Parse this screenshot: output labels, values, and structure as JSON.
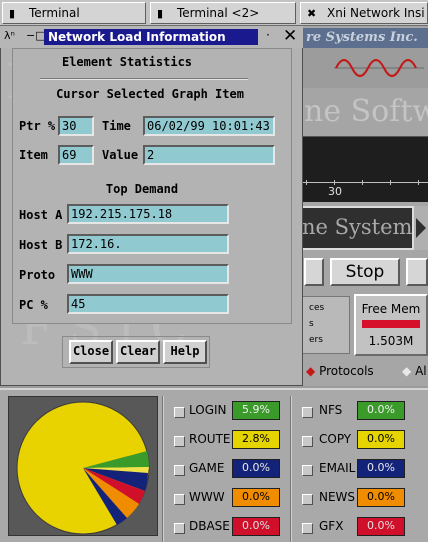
{
  "taskbar": {
    "tabs": [
      {
        "label": "Terminal",
        "icon": "terminal-icon"
      },
      {
        "label": "Terminal <2>",
        "icon": "terminal-icon"
      },
      {
        "label": "Xni Network Insi",
        "icon": "x-icon"
      }
    ]
  },
  "background_app": {
    "title_fragment": "re Systems Inc.",
    "brand_fragment": "ne Softwa",
    "graph_tick": "30",
    "logo_fragment": "ne Systems",
    "stop_label": "Stop",
    "options": [
      "ces",
      "s",
      "ers"
    ],
    "free_mem": {
      "label": "Free Mem",
      "value": "1.503M"
    },
    "radios": [
      {
        "label": "Protocols",
        "selected": true
      },
      {
        "label": "Al",
        "selected": false
      }
    ]
  },
  "protocols": {
    "columns": [
      [
        {
          "name": "LOGIN",
          "value": "5.9%",
          "color": "#3a9a2a"
        },
        {
          "name": "ROUTE",
          "value": "2.8%",
          "color": "#e6d400"
        },
        {
          "name": "GAME",
          "value": "0.0%",
          "color": "#14237a"
        },
        {
          "name": "WWW",
          "value": "0.0%",
          "color": "#f08c00"
        },
        {
          "name": "DBASE",
          "value": "0.0%",
          "color": "#d0102a"
        }
      ],
      [
        {
          "name": "NFS",
          "value": "0.0%",
          "color": "#3a9a2a"
        },
        {
          "name": "COPY",
          "value": "0.0%",
          "color": "#e6d400"
        },
        {
          "name": "EMAIL",
          "value": "0.0%",
          "color": "#14237a"
        },
        {
          "name": "NEWS",
          "value": "0.0%",
          "color": "#f08c00"
        },
        {
          "name": "GFX",
          "value": "0.0%",
          "color": "#d0102a"
        }
      ]
    ]
  },
  "dialog": {
    "title": "Network Load Information",
    "heading": "Element Statistics",
    "subheading": "Cursor Selected Graph Item",
    "ptr_label": "Ptr %",
    "ptr_value": "30",
    "time_label": "Time",
    "time_value": "06/02/99 10:01:43",
    "item_label": "Item",
    "item_value": "69",
    "value_label": "Value",
    "value_value": "2",
    "top_demand": "Top Demand",
    "host_a_label": "Host A",
    "host_a_value": "192.215.175.18",
    "host_b_label": "Host B",
    "host_b_value": "172.16.",
    "proto_label": "Proto",
    "proto_value": "WWW",
    "pc_label": "PC %",
    "pc_value": "45",
    "close_label": "Close",
    "clear_label": "Clear",
    "help_label": "Help"
  }
}
